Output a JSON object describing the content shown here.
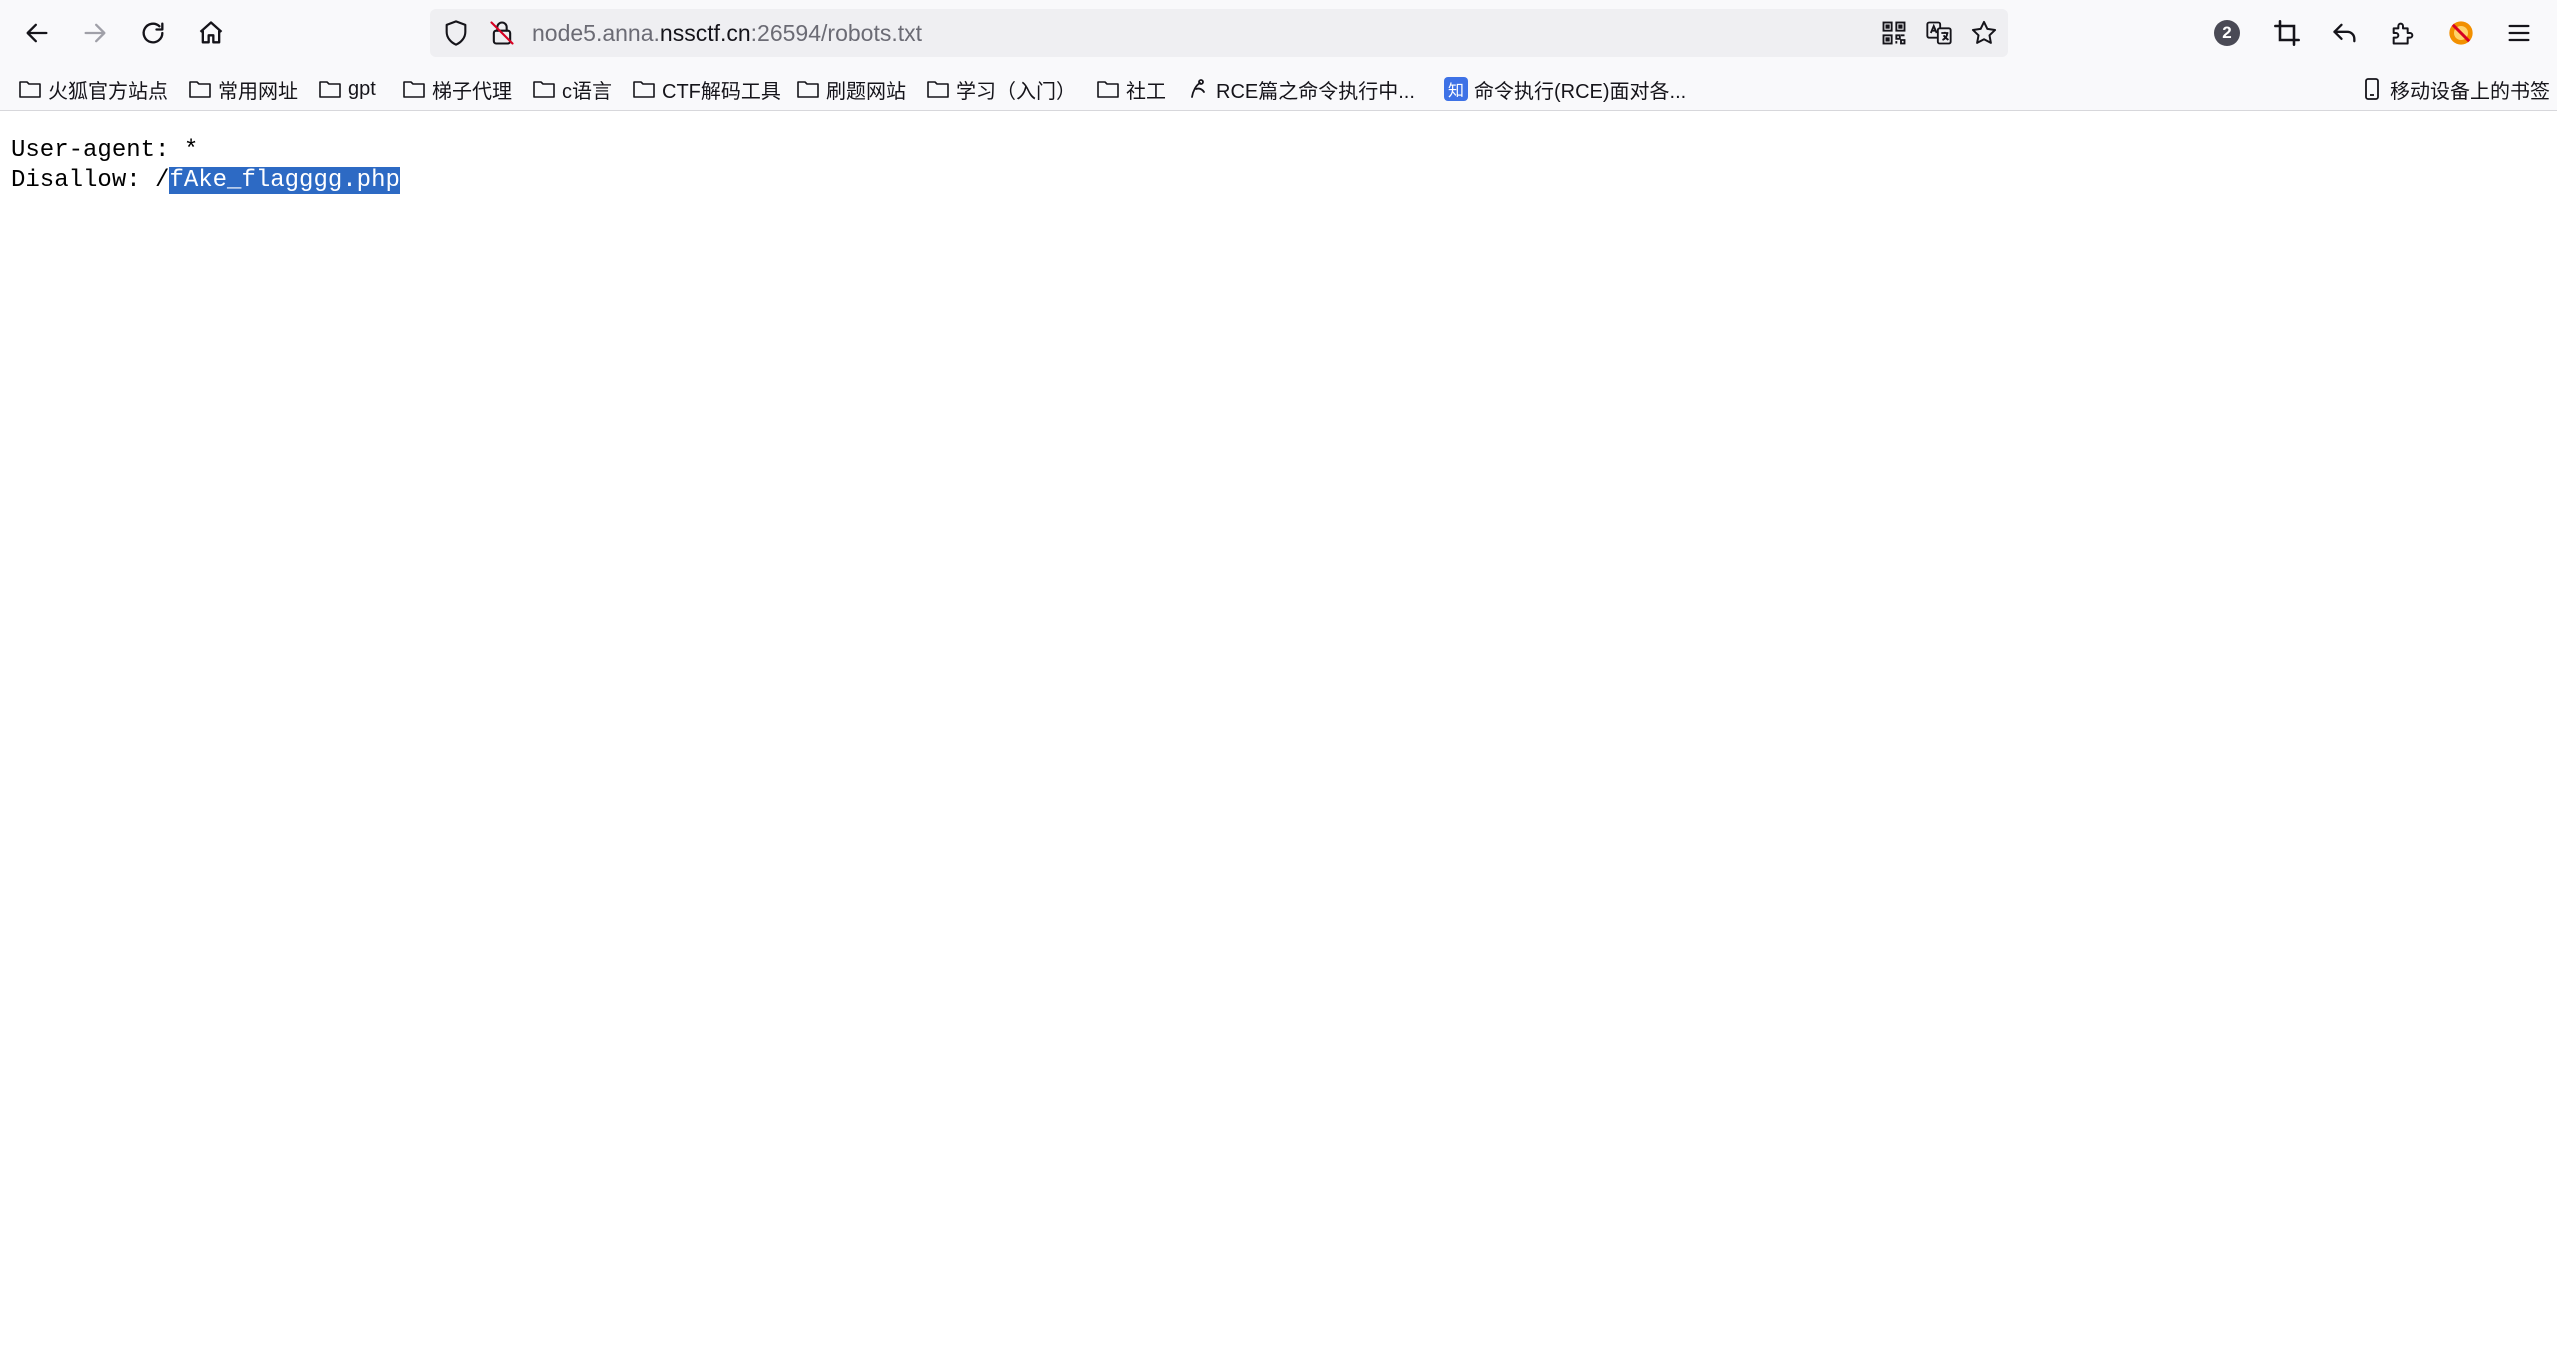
{
  "browser": {
    "url_host_prefix": "node5.anna.",
    "url_domain": "nssctf.cn",
    "url_rest": ":26594/robots.txt",
    "extension_badge_count": "2"
  },
  "bookmarks": [
    {
      "label": "火狐官方站点",
      "icon": "folder-icon"
    },
    {
      "label": "常用网址",
      "icon": "folder-icon"
    },
    {
      "label": "gpt",
      "icon": "folder-icon"
    },
    {
      "label": "梯子代理",
      "icon": "folder-icon"
    },
    {
      "label": "c语言",
      "icon": "folder-icon"
    },
    {
      "label": "CTF解码工具",
      "icon": "folder-icon"
    },
    {
      "label": "刷题网站",
      "icon": "folder-icon"
    },
    {
      "label": "学习（入门）",
      "icon": "folder-icon"
    },
    {
      "label": "社工",
      "icon": "folder-icon"
    },
    {
      "label": "RCE篇之命令执行中...",
      "icon": "site-icon"
    },
    {
      "label": "命令执行(RCE)面对各...",
      "icon": "zhihu-icon",
      "icon_text": "知"
    }
  ],
  "mobile_bookmarks": "移动设备上的书签",
  "document": {
    "line1": "User-agent: *",
    "line2_prefix": "Disallow: /",
    "line2_selected": "fAke_flagggg.php"
  },
  "colors": {
    "selection": "#2d6ac4",
    "toolbar_bg": "#f9f9fb",
    "urlbar_bg": "#efeff2"
  }
}
